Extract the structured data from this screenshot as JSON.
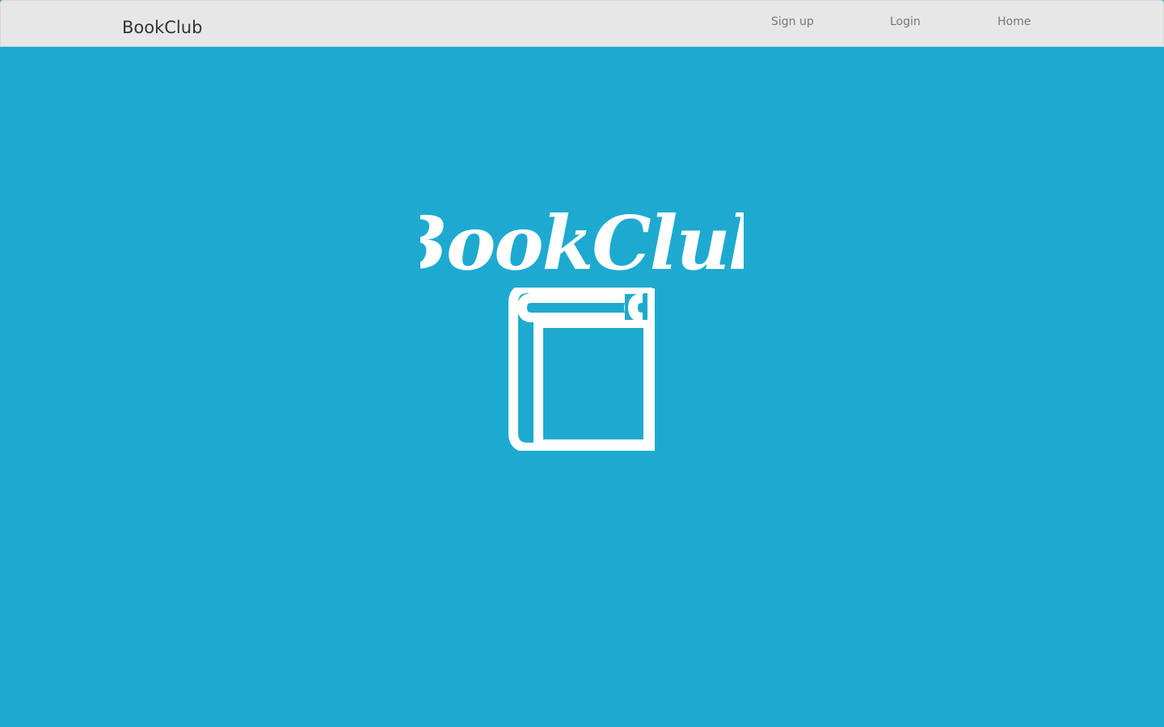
{
  "navbar": {
    "brand": "BookClub",
    "links": [
      {
        "label": "Sign up"
      },
      {
        "label": "Login"
      },
      {
        "label": "Home"
      }
    ]
  },
  "hero": {
    "title": "BookClub",
    "icon": "book-icon"
  },
  "colors": {
    "background": "#1eaad0",
    "navbar": "#e7e7e7",
    "hero_text": "#ffffff"
  }
}
